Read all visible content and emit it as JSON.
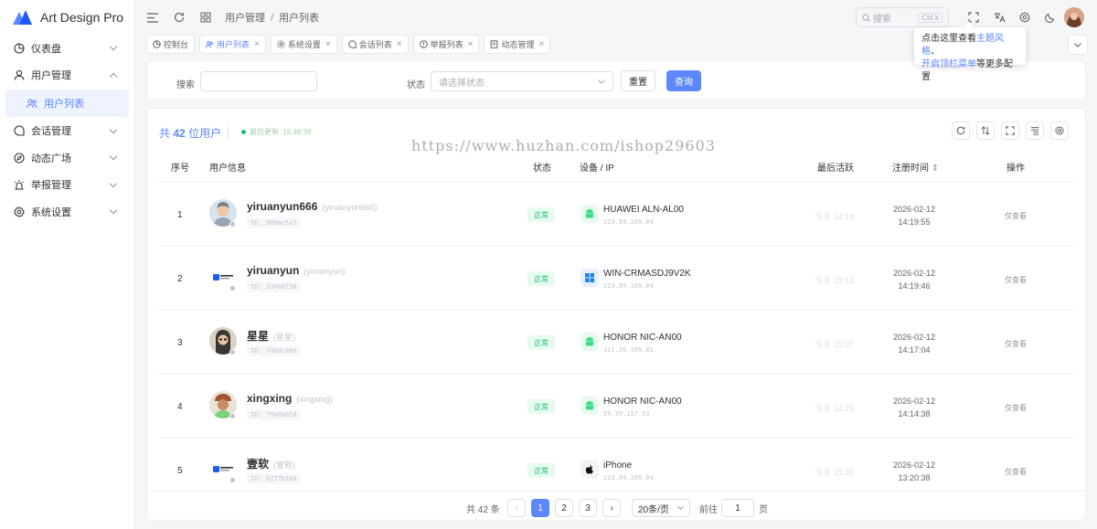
{
  "app": {
    "title": "Art Design Pro"
  },
  "sidebar": {
    "items": [
      {
        "label": "仪表盘"
      },
      {
        "label": "用户管理"
      },
      {
        "label": "用户列表"
      },
      {
        "label": "会话管理"
      },
      {
        "label": "动态广场"
      },
      {
        "label": "举报管理"
      },
      {
        "label": "系统设置"
      }
    ]
  },
  "header": {
    "breadcrumb": [
      "用户管理",
      "用户列表"
    ],
    "breadcrumb_sep": "/",
    "search_placeholder": "搜索",
    "search_kbd": "Ctrl k"
  },
  "tabs": [
    {
      "label": "控制台"
    },
    {
      "label": "用户列表"
    },
    {
      "label": "系统设置"
    },
    {
      "label": "会话列表"
    },
    {
      "label": "举报列表"
    },
    {
      "label": "动态管理"
    }
  ],
  "tooltip": {
    "pre": "点击这里查看",
    "link1": "主题风格",
    "mid": "、",
    "link2": "开启顶栏菜单",
    "post": "等更多配置"
  },
  "filter": {
    "search_label": "搜索",
    "status_label": "状态",
    "status_placeholder": "请选择状态",
    "reset_label": "重置",
    "query_label": "查询"
  },
  "summary": {
    "prefix": "共",
    "count": "42",
    "suffix": "位用户",
    "updated": "最后更新: 15:46:39"
  },
  "table": {
    "headers": {
      "index": "序号",
      "user": "用户信息",
      "status": "状态",
      "device": "设备 / IP",
      "last": "最后活跃",
      "reg": "注册时间",
      "op": "操作"
    },
    "rows": [
      {
        "index": "1",
        "name": "yiruanyun666",
        "alias": "(yiruanyun666)",
        "id": "ID: 989ae5a7",
        "status": "正常",
        "device": "HUAWEI ALN-AL00",
        "ip": "223.89.109.84",
        "last": "今天 14:19",
        "reg_date": "2026-02-12",
        "reg_time": "14:19:55",
        "op": "仅查看"
      },
      {
        "index": "2",
        "name": "yiruanyun",
        "alias": "(yiruanyun)",
        "id": "ID: 334b6f56",
        "status": "正常",
        "device": "WIN-CRMASDJ9V2K",
        "ip": "223.89.109.84",
        "last": "今天 15:43",
        "reg_date": "2026-02-12",
        "reg_time": "14:19:46",
        "op": "仅查看"
      },
      {
        "index": "3",
        "name": "星星",
        "alias": "(星星)",
        "id": "ID: 7d8dc09d",
        "status": "正常",
        "device": "HONOR NIC-AN00",
        "ip": "111.26.189.81",
        "last": "今天 15:07",
        "reg_date": "2026-02-12",
        "reg_time": "14:17:04",
        "op": "仅查看"
      },
      {
        "index": "4",
        "name": "xingxing",
        "alias": "(xingxing)",
        "id": "ID: 7940b05d",
        "status": "正常",
        "device": "HONOR NIC-AN00",
        "ip": "59.39.157.53",
        "last": "今天 14:25",
        "reg_date": "2026-02-12",
        "reg_time": "14:14:38",
        "op": "仅查看"
      },
      {
        "index": "5",
        "name": "壹软",
        "alias": "(壹软)",
        "id": "ID: 0257b160",
        "status": "正常",
        "device": "iPhone",
        "ip": "223.89.109.84",
        "last": "今天 15:35",
        "reg_date": "2026-02-12",
        "reg_time": "13:20:38",
        "op": "仅查看"
      }
    ]
  },
  "pagination": {
    "total": "共 42 条",
    "pages": [
      "1",
      "2",
      "3"
    ],
    "page_size": "20条/页",
    "goto_label": "前往",
    "goto_value": "1",
    "goto_suffix": "页",
    "prev": "‹",
    "next": "›"
  },
  "watermark": "https://www.huzhan.com/ishop29603",
  "colors": {
    "accent": "#5d87ff",
    "success": "#13c36b"
  }
}
